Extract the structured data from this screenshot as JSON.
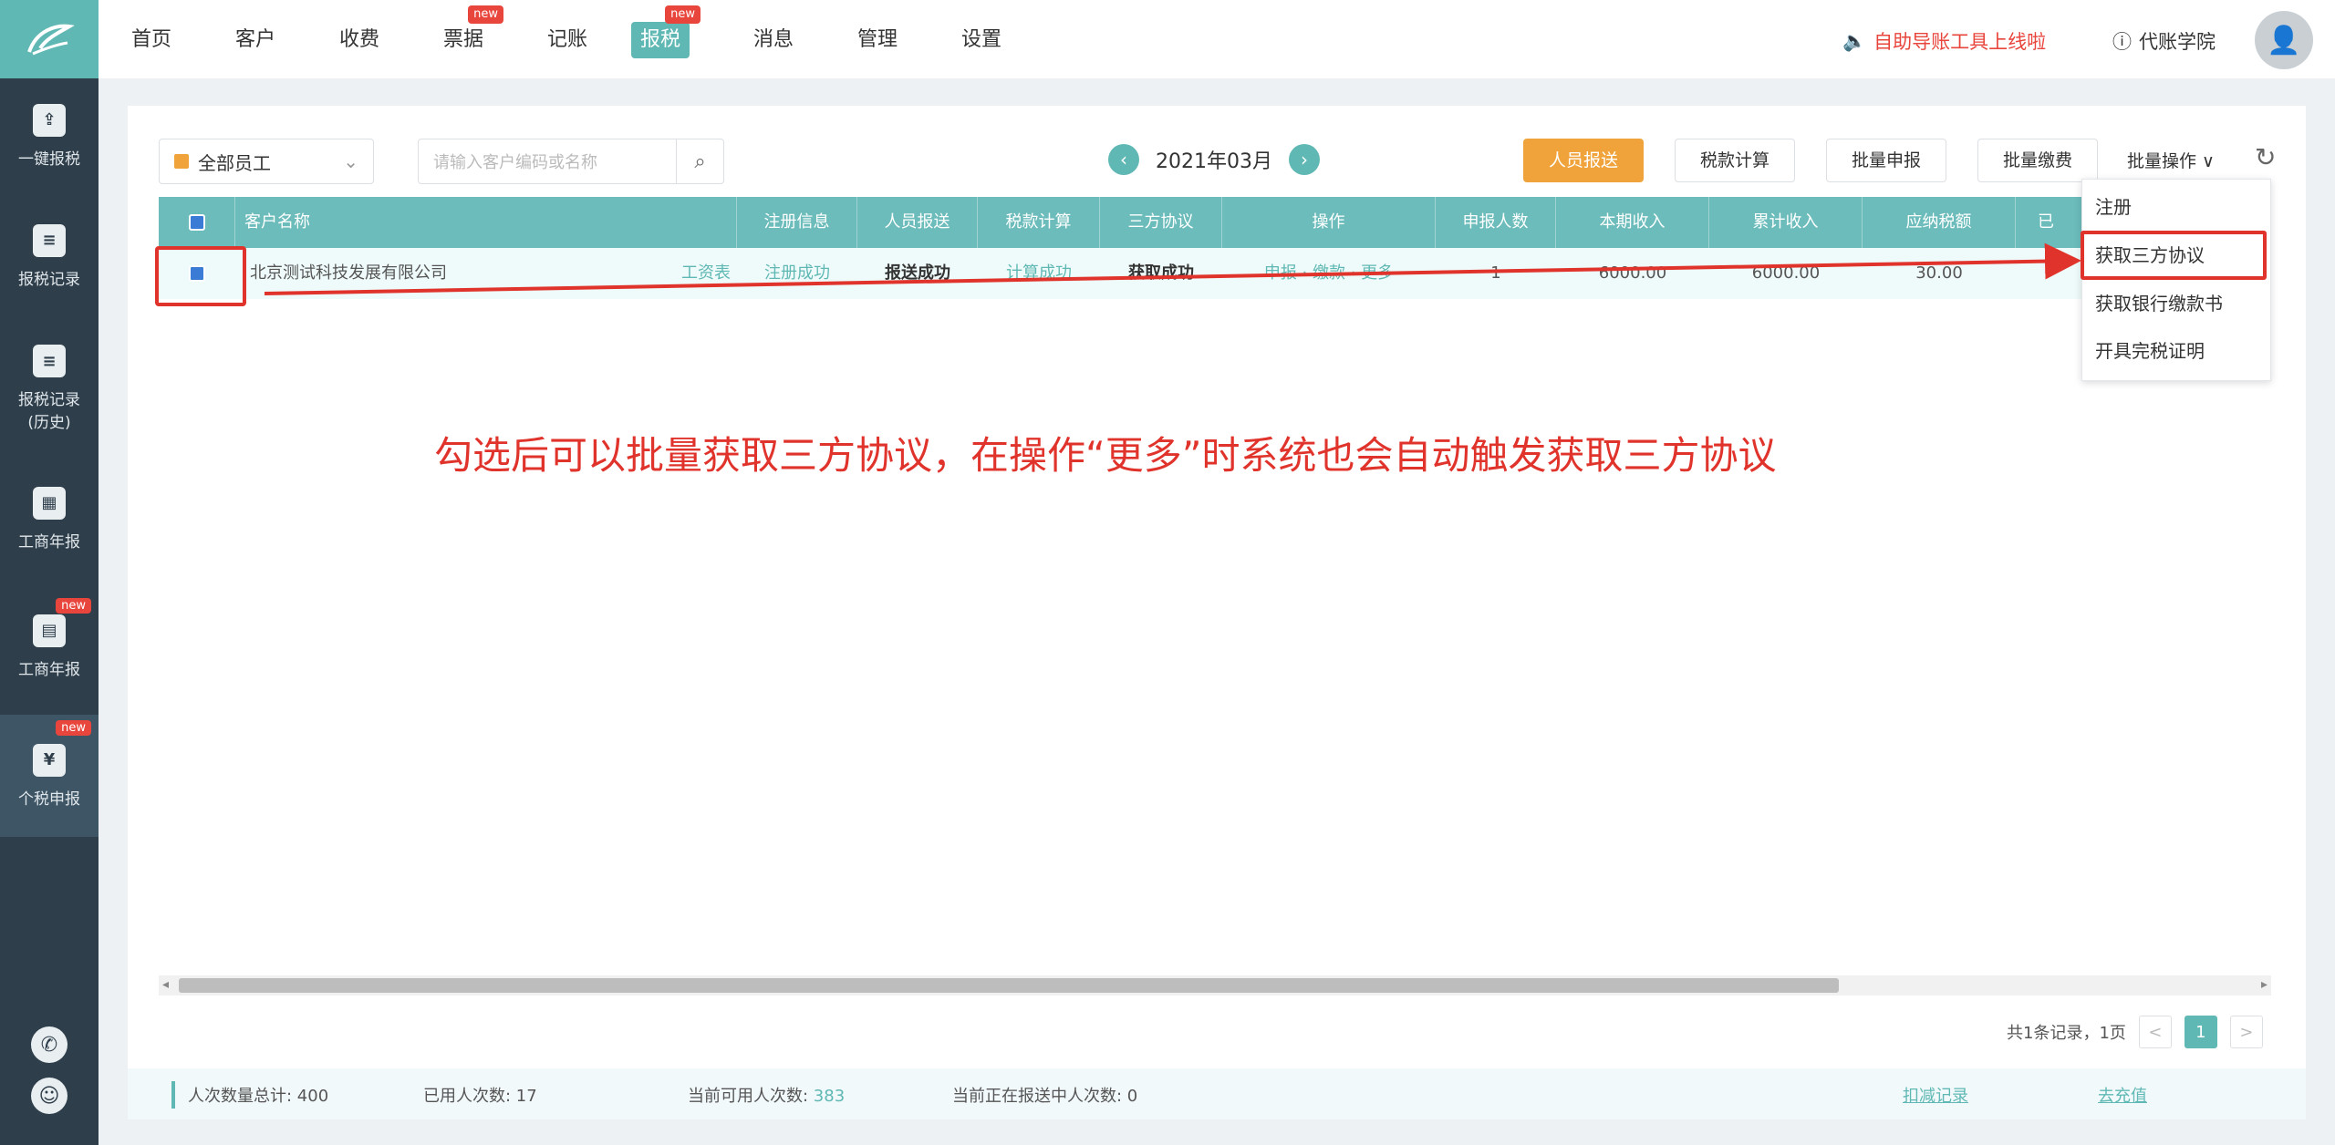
{
  "nav": {
    "items": [
      {
        "label": "首页",
        "new": false
      },
      {
        "label": "客户",
        "new": false
      },
      {
        "label": "收费",
        "new": false
      },
      {
        "label": "票据",
        "new": true
      },
      {
        "label": "记账",
        "new": false
      },
      {
        "label": "报税",
        "new": true,
        "active": true
      },
      {
        "label": "消息",
        "new": false
      },
      {
        "label": "管理",
        "new": false
      },
      {
        "label": "设置",
        "new": false
      }
    ],
    "new_badge": "new",
    "right_link_1": "自助导账工具上线啦",
    "right_link_2": "代账学院"
  },
  "sidebar": {
    "items": [
      {
        "label": "一键报税",
        "new": false
      },
      {
        "label": "报税记录",
        "new": false
      },
      {
        "label": "报税记录(历史)",
        "new": false
      },
      {
        "label": "工商年报",
        "new": false
      },
      {
        "label": "工商年报",
        "new": true
      },
      {
        "label": "个税申报",
        "new": true,
        "active": true
      }
    ],
    "new_badge": "new"
  },
  "toolbar": {
    "staff_select": "全部员工",
    "search_placeholder": "请输入客户编码或名称",
    "month": "2021年03月",
    "btn_personnel": "人员报送",
    "btn_tax_calc": "税款计算",
    "btn_batch_declare": "批量申报",
    "btn_batch_pay": "批量缴费",
    "batch_op": "批量操作 ∨"
  },
  "table": {
    "columns": [
      "客户名称",
      "注册信息",
      "人员报送",
      "税款计算",
      "三方协议",
      "操作",
      "申报人数",
      "本期收入",
      "累计收入",
      "应纳税额",
      "已"
    ],
    "rows": [
      {
        "client": "北京测试科技发展有限公司",
        "tag": "工资表",
        "reg": "注册成功",
        "personnel": "报送成功",
        "tax_calc": "计算成功",
        "agreement": "获取成功",
        "ops": "申报 · 缴款 · 更多",
        "count": "1",
        "income": "6000.00",
        "cum_income": "6000.00",
        "tax": "30.00"
      }
    ]
  },
  "dropdown": {
    "items": [
      "注册",
      "获取三方协议",
      "获取银行缴款书",
      "开具完税证明"
    ]
  },
  "pager": {
    "summary": "共1条记录，1页",
    "prev": "<",
    "page": "1",
    "next": ">"
  },
  "stats": {
    "total_label": "人次数量总计: ",
    "total": "400",
    "used_label": "已用人次数: ",
    "used": "17",
    "available_label": "当前可用人次数: ",
    "available": "383",
    "pending_label": "当前正在报送中人次数: ",
    "pending": "0",
    "link_1": "扣减记录",
    "link_2": "去充值"
  },
  "annotation": {
    "text": "勾选后可以批量获取三方协议，在操作“更多”时系统也会自动触发获取三方协议"
  },
  "colors": {
    "accent": "#5fb8b4",
    "sidebar": "#2f3e4b",
    "alert": "#e0332b",
    "orange": "#f0a33a"
  }
}
